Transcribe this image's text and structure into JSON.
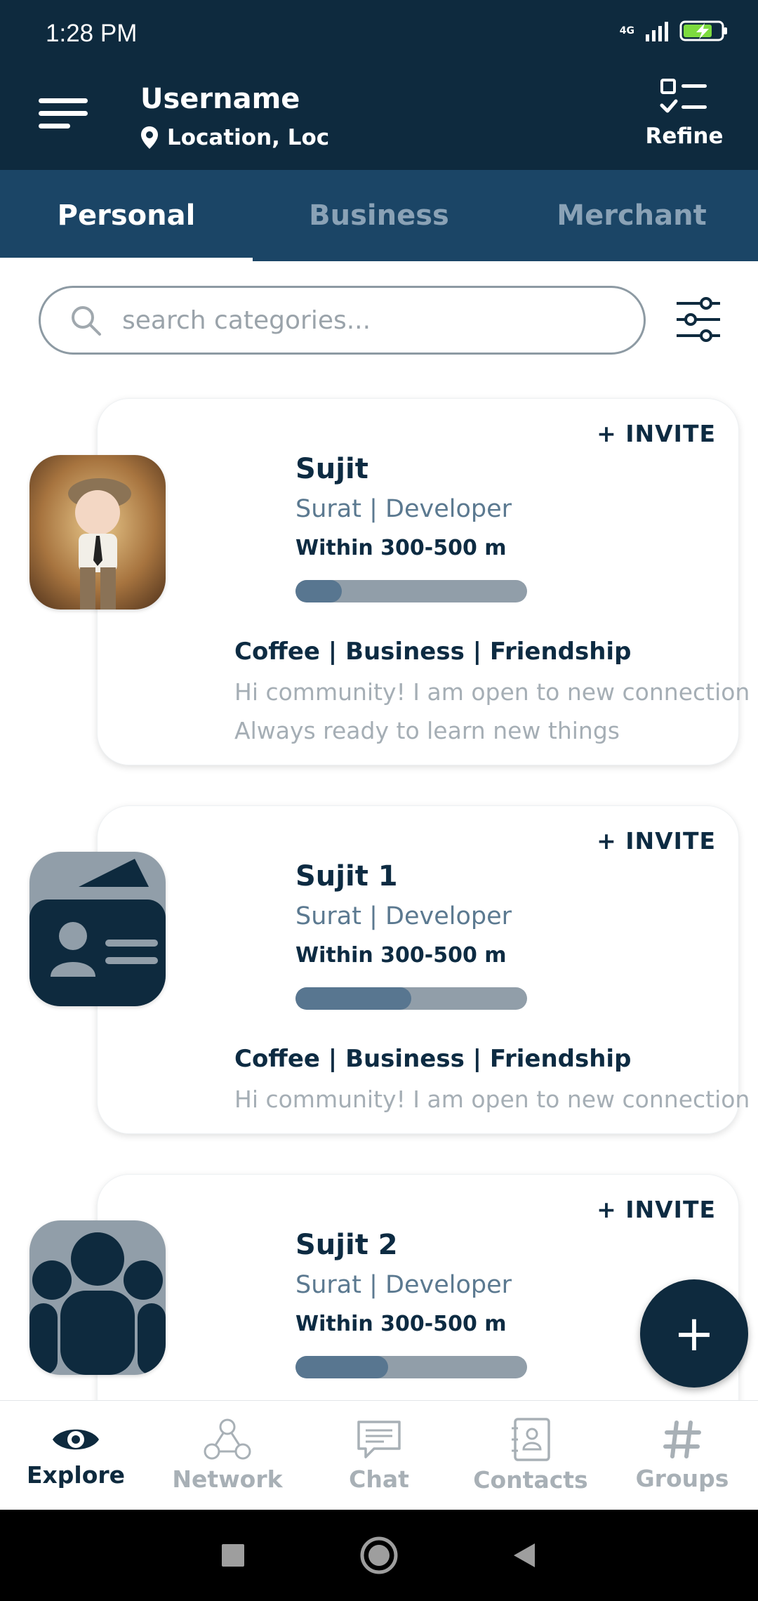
{
  "status_bar": {
    "time": "1:28 PM",
    "network": "4G"
  },
  "header": {
    "username": "Username",
    "location": "Location, Loc",
    "refine_label": "Refine"
  },
  "tabs": [
    {
      "label": "Personal",
      "active": true
    },
    {
      "label": "Business",
      "active": false
    },
    {
      "label": "Merchant",
      "active": false
    }
  ],
  "search": {
    "placeholder": "search categories..."
  },
  "cards": [
    {
      "name": "Sujit",
      "role": "Surat | Developer",
      "distance": "Within 300-500 m",
      "progress": 0.2,
      "invite": "+ INVITE",
      "interests": "Coffee | Business | Friendship",
      "bio_lines": [
        "Hi community! I am open to new connection",
        "Always ready to learn new things"
      ],
      "avatar": "doll-photo"
    },
    {
      "name": "Sujit 1",
      "role": "Surat | Developer",
      "distance": "Within 300-500 m",
      "progress": 0.5,
      "invite": "+ INVITE",
      "interests": "Coffee | Business | Friendship",
      "bio_lines": [
        "Hi community! I am open to new connection"
      ],
      "avatar": "id-card-icon"
    },
    {
      "name": "Sujit 2",
      "role": "Surat | Developer",
      "distance": "Within 300-500 m",
      "progress": 0.4,
      "invite": "+ INVITE",
      "avatar": "group-icon"
    }
  ],
  "fab": {
    "label": "+"
  },
  "bottom_nav": [
    {
      "label": "Explore",
      "icon": "eye-icon",
      "active": true
    },
    {
      "label": "Network",
      "icon": "network-icon",
      "active": false
    },
    {
      "label": "Chat",
      "icon": "chat-icon",
      "active": false
    },
    {
      "label": "Contacts",
      "icon": "contacts-icon",
      "active": false
    },
    {
      "label": "Groups",
      "icon": "hashtag-icon",
      "active": false
    }
  ],
  "colors": {
    "primary": "#0e2a3e",
    "tab_bar": "#1b4566",
    "bar_track": "#919ea9",
    "bar_fill": "#587690"
  }
}
